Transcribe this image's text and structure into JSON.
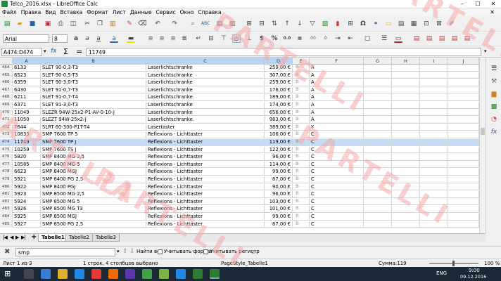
{
  "window": {
    "title": "Telco_2016.xlsx - LibreOffice Calc",
    "min": "–",
    "max": "☐",
    "close": "✕"
  },
  "menu": [
    "Файл",
    "Правка",
    "Вид",
    "Вставка",
    "Формат",
    "Лист",
    "Данные",
    "Сервис",
    "Окно",
    "Справка"
  ],
  "toolbar": {
    "font": "Arial",
    "size": "8"
  },
  "formula": {
    "cellref": "A474:D474",
    "content": "11749",
    "sum_symbol": "Σ",
    "equals_symbol": "="
  },
  "columns": [
    "A",
    "B",
    "C",
    "D",
    "E",
    "F",
    "G",
    "H",
    "I",
    "J"
  ],
  "rows": [
    {
      "n": "464",
      "a": "6133",
      "b": "SLET 90-0,3-T3",
      "c": "Laserlichtschranke",
      "d": "259,00 €",
      "e": "",
      "f": "A"
    },
    {
      "n": "465",
      "a": "6523",
      "b": "SLET 90-0,5-T3",
      "c": "Laserlichtschranke",
      "d": "307,00 €",
      "e": "",
      "f": "A"
    },
    {
      "n": "466",
      "a": "6359",
      "b": "SLET 90-3,0-T3",
      "c": "Laserlichtschranke",
      "d": "259,00 €",
      "e": "",
      "f": "A"
    },
    {
      "n": "467",
      "a": "6430",
      "b": "SLET 91-0,7-T3",
      "c": "Laserlichtschranke",
      "d": "176,00 €",
      "e": "",
      "f": "A"
    },
    {
      "n": "468",
      "a": "6211",
      "b": "SLET 91-0,7-T4",
      "c": "Laserlichtschranke",
      "d": "189,00 €",
      "e": "",
      "f": "A"
    },
    {
      "n": "469",
      "a": "6371",
      "b": "SLET 91-3,0-T3",
      "c": "Laserlichtschranke",
      "d": "174,00 €",
      "e": "",
      "f": "A"
    },
    {
      "n": "470",
      "a": "11049",
      "b": "SLEZR 94W-25x2-P1-AV-0-10-J",
      "c": "Laserlichtschranke",
      "d": "656,00 €",
      "e": "",
      "f": "A"
    },
    {
      "n": "471",
      "a": "11050",
      "b": "SLEZT 94W-25x2-J",
      "c": "Laserlichtschranke",
      "d": "983,00 €",
      "e": "",
      "f": "A"
    },
    {
      "n": "472",
      "a": "7644",
      "b": "SLRT 60-300-P1T-T4",
      "c": "Lasertaster",
      "d": "389,00 €",
      "e": "",
      "f": "Y"
    },
    {
      "n": "473",
      "a": "10833",
      "b": "SMP 7600 TP 5",
      "c": "Reflexions - Lichttaster",
      "d": "106,00 €",
      "e": "",
      "f": "C"
    },
    {
      "n": "474",
      "a": "11749",
      "b": "SMP 7600 TP J",
      "c": "Reflexions - Lichttaster",
      "d": "119,00 €",
      "e": "",
      "f": "C"
    },
    {
      "n": "475",
      "a": "10259",
      "b": "SMP 7600 TS J",
      "c": "Reflexions - Lichttaster",
      "d": "122,00 €",
      "e": "",
      "f": "C"
    },
    {
      "n": "476",
      "a": "5820",
      "b": "SMP 8400 MG 2,5",
      "c": "Reflexions - Lichttaster",
      "d": "96,00 €",
      "e": "",
      "f": "C"
    },
    {
      "n": "477",
      "a": "10585",
      "b": "SMP 8400 MG 5",
      "c": "Reflexions - Lichttaster",
      "d": "114,00 €",
      "e": "",
      "f": "C"
    },
    {
      "n": "478",
      "a": "6623",
      "b": "SMP 8400 MGJ",
      "c": "Reflexions - Lichttaster",
      "d": "99,00 €",
      "e": "",
      "f": "C"
    },
    {
      "n": "479",
      "a": "5921",
      "b": "SMP 8400 PG 2,5",
      "c": "Reflexions - Lichttaster",
      "d": "87,00 €",
      "e": "",
      "f": "C"
    },
    {
      "n": "480",
      "a": "5922",
      "b": "SMP 8400 PGJ",
      "c": "Reflexions - Lichttaster",
      "d": "90,00 €",
      "e": "",
      "f": "C"
    },
    {
      "n": "481",
      "a": "5923",
      "b": "SMP 8500 MG 2,5",
      "c": "Reflexions - Lichttaster",
      "d": "96,00 €",
      "e": "",
      "f": "C"
    },
    {
      "n": "482",
      "a": "5924",
      "b": "SMP 8500 MG 5",
      "c": "Reflexions - Lichttaster",
      "d": "103,00 €",
      "e": "",
      "f": "C"
    },
    {
      "n": "483",
      "a": "5926",
      "b": "SMP 8500 MG T3",
      "c": "Reflexions - Lichttaster",
      "d": "101,00 €",
      "e": "",
      "f": "C"
    },
    {
      "n": "484",
      "a": "5925",
      "b": "SMP 8500 MGJ",
      "c": "Reflexions - Lichttaster",
      "d": "99,00 €",
      "e": "",
      "f": "C"
    },
    {
      "n": "485",
      "a": "5927",
      "b": "SMP 8500 PG 2,5",
      "c": "Reflexions - Lichttaster",
      "d": "87,00 €",
      "e": "",
      "f": "C"
    }
  ],
  "sheets": [
    "Tabelle1",
    "Tabelle2",
    "Tabelle3"
  ],
  "find": {
    "value": "smp",
    "find_all": "Найти все",
    "match_format": "Учитывать формат",
    "match_case": "Учитывать регистр"
  },
  "status": {
    "sheet": "Лист 1 из 3",
    "selection": "1 строк, 4 столбцов выбрано",
    "pagestyle": "PageStyle_Tabelle1",
    "sum": "Сумма:119",
    "zoom": "100 %"
  },
  "taskbar": {
    "lang": "ENG",
    "time": "9:00",
    "date": "09.12.2016"
  },
  "watermark": "PARTELLI",
  "colors": {
    "selected_row": "#c5dcf3",
    "selected_header": "#b9d3f0",
    "watermark": "#f4a8a8",
    "taskbar": "#1b2836"
  }
}
